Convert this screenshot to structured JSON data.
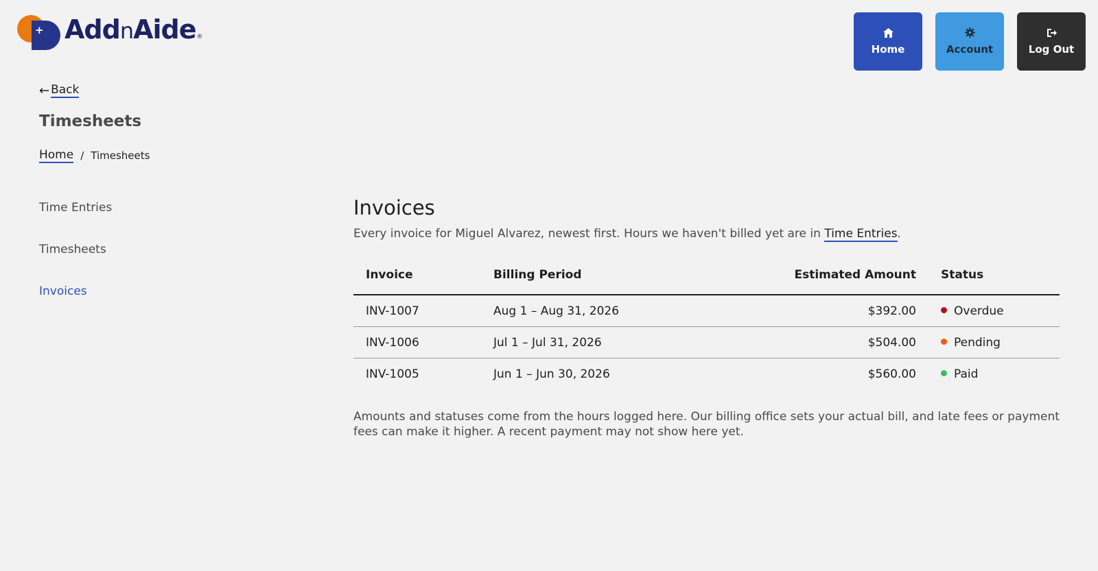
{
  "brand": {
    "name_part1": "Add",
    "name_part2": "n",
    "name_part3": "Aide",
    "registered": "®",
    "plus": "+"
  },
  "nav": {
    "home": {
      "label": "Home",
      "icon": "home-icon"
    },
    "account": {
      "label": "Account",
      "icon": "gear-icon"
    },
    "logout": {
      "label": "Log Out",
      "icon": "logout-icon"
    }
  },
  "back": {
    "arrow": "←",
    "label": "Back"
  },
  "page_title": "Timesheets",
  "breadcrumb": {
    "home": "Home",
    "separator": "/",
    "current": "Timesheets"
  },
  "sidebar": {
    "items": [
      {
        "label": "Time Entries"
      },
      {
        "label": "Timesheets"
      },
      {
        "label": "Invoices",
        "active": true
      }
    ]
  },
  "main": {
    "title": "Invoices",
    "intro_text": "Every invoice for Miguel Alvarez, newest first. Hours we haven't billed yet are in ",
    "intro_link": "Time Entries",
    "intro_end": ".",
    "table": {
      "headers": {
        "invoice": "Invoice",
        "period": "Billing Period",
        "amount": "Estimated Amount",
        "status": "Status"
      },
      "rows": [
        {
          "invoice": "INV-1007",
          "period": "Aug 1 – Aug 31, 2026",
          "amount": "$392.00",
          "status": "Overdue",
          "status_color": "#b3121a"
        },
        {
          "invoice": "INV-1006",
          "period": "Jul 1 – Jul 31, 2026",
          "amount": "$504.00",
          "status": "Pending",
          "status_color": "#f05a14"
        },
        {
          "invoice": "INV-1005",
          "period": "Jun 1 – Jun 30, 2026",
          "amount": "$560.00",
          "status": "Paid",
          "status_color": "#3cbc5c"
        }
      ]
    },
    "note": "Amounts and statuses come from the hours logged here. Our billing office sets your actual bill, and late fees or payment fees can make it higher. A recent payment may not show here yet."
  }
}
